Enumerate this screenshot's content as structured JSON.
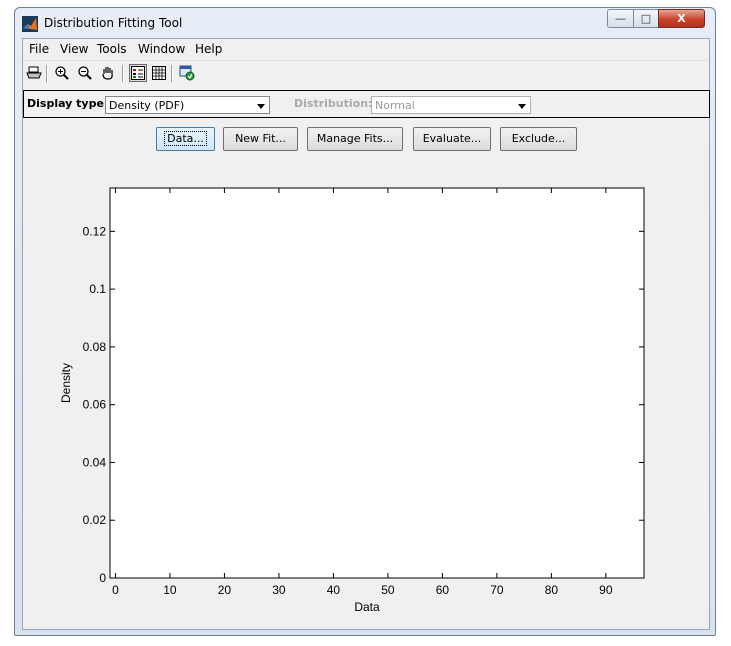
{
  "window": {
    "title": "Distribution Fitting Tool",
    "caption_buttons": {
      "minimize": "—",
      "maximize": "□",
      "close": "X"
    }
  },
  "menu": [
    "File",
    "View",
    "Tools",
    "Window",
    "Help"
  ],
  "toolbar": [
    "print-icon",
    "zoom-in-icon",
    "zoom-out-icon",
    "pan-hand-icon",
    "legend-icon",
    "grid-icon",
    "dock-icon"
  ],
  "controls": {
    "display_type_label": "Display type:",
    "display_type_value": "Density (PDF)",
    "distribution_label": "Distribution:",
    "distribution_value": "Normal"
  },
  "buttons": {
    "data": "Data...",
    "new_fit": "New Fit...",
    "manage_fits": "Manage Fits...",
    "evaluate": "Evaluate...",
    "exclude": "Exclude..."
  },
  "chart_data": {
    "type": "line",
    "xlabel": "Data",
    "ylabel": "Density",
    "xlim": [
      -1,
      97
    ],
    "ylim": [
      0,
      0.135
    ],
    "xticks": [
      0,
      10,
      20,
      30,
      40,
      50,
      60,
      70,
      80,
      90
    ],
    "yticks": [
      0,
      0.02,
      0.04,
      0.06,
      0.08,
      0.1,
      0.12
    ],
    "ytick_labels": [
      "0",
      "0.02",
      "0.04",
      "0.06",
      "0.08",
      "0.1",
      "0.12"
    ],
    "series": [],
    "grid": false
  }
}
